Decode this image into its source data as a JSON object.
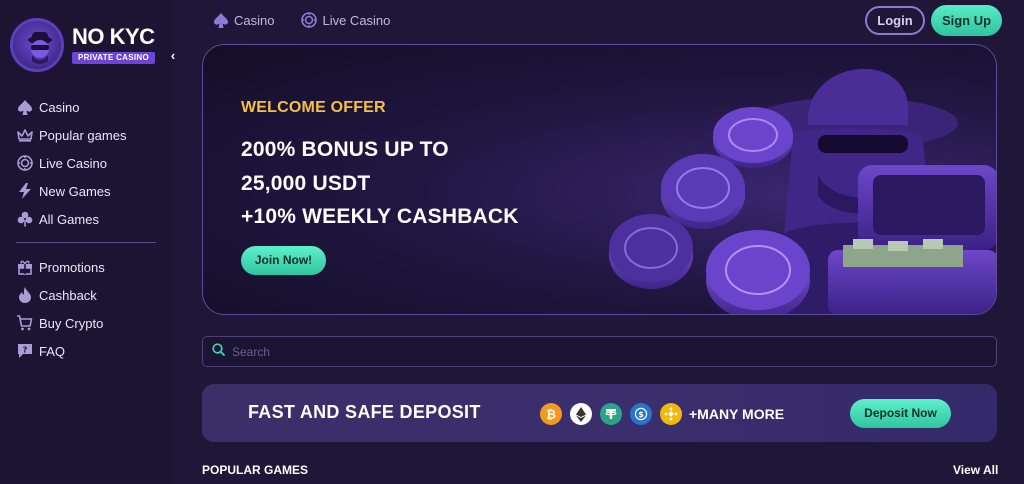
{
  "brand": {
    "name": "NO KYC",
    "tagline": "PRIVATE CASINO"
  },
  "sidebar": {
    "collapse_glyph": "‹",
    "items": [
      {
        "label": "Casino",
        "icon": "spade-icon"
      },
      {
        "label": "Popular games",
        "icon": "crown-icon"
      },
      {
        "label": "Live Casino",
        "icon": "chip-icon"
      },
      {
        "label": "New Games",
        "icon": "lightning-icon"
      },
      {
        "label": "All Games",
        "icon": "clover-icon"
      }
    ],
    "secondary_items": [
      {
        "label": "Promotions",
        "icon": "gift-icon"
      },
      {
        "label": "Cashback",
        "icon": "flame-icon"
      },
      {
        "label": "Buy Crypto",
        "icon": "cart-icon"
      },
      {
        "label": "FAQ",
        "icon": "chat-question-icon"
      }
    ]
  },
  "topnav": {
    "items": [
      {
        "label": "Casino",
        "icon": "spade-icon"
      },
      {
        "label": "Live Casino",
        "icon": "chip-icon"
      }
    ],
    "login_label": "Login",
    "signup_label": "Sign Up"
  },
  "banner": {
    "eyebrow": "WELCOME OFFER",
    "line1": "200% BONUS UP TO",
    "line2": "25,000 USDT",
    "line3": "+10% WEEKLY CASHBACK",
    "cta_label": "Join Now!"
  },
  "search": {
    "placeholder": "Search"
  },
  "deposit": {
    "title": "FAST AND SAFE DEPOSIT",
    "coins": [
      "bitcoin-icon",
      "ethereum-icon",
      "tether-icon",
      "usdc-icon",
      "bnb-icon"
    ],
    "more_label": "+MANY MORE",
    "cta_label": "Deposit Now"
  },
  "popular": {
    "title": "POPULAR GAMES",
    "view_all_label": "View All"
  },
  "colors": {
    "accent_green": "#3fd8b2",
    "accent_purple": "#6b46d6",
    "gold": "#f4c044"
  }
}
